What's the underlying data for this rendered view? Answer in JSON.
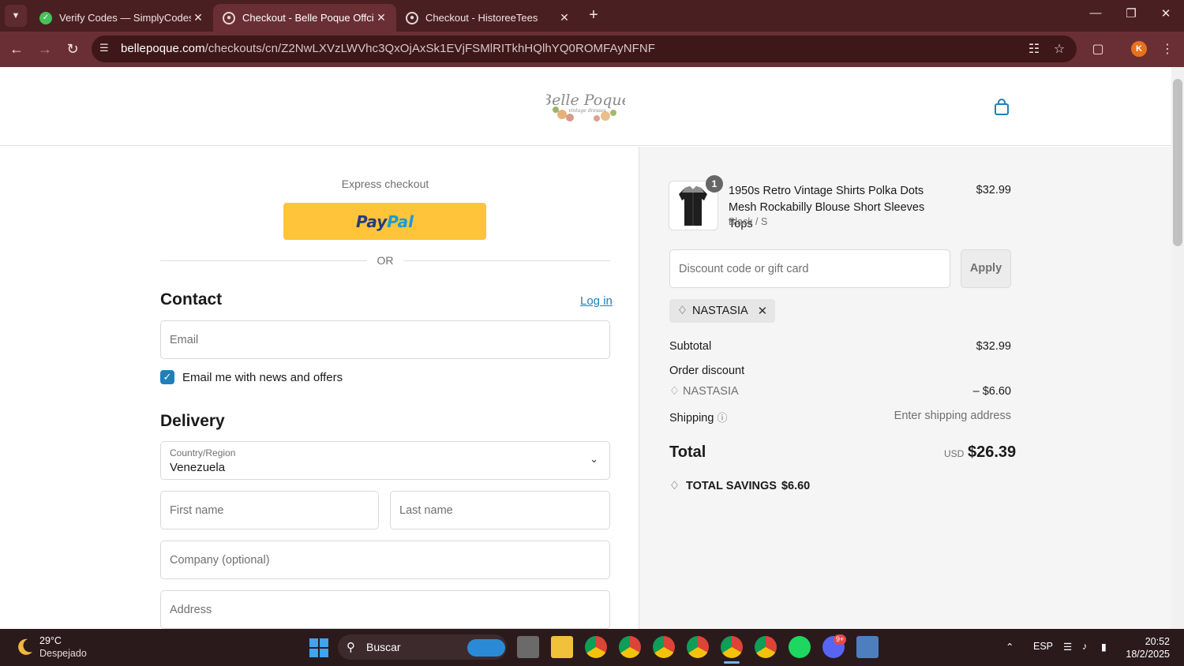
{
  "browser": {
    "tabs": [
      {
        "title": "Verify Codes — SimplyCodes",
        "active": false
      },
      {
        "title": "Checkout - Belle Poque Offcial",
        "active": true
      },
      {
        "title": "Checkout - HistoreeTees",
        "active": false
      }
    ],
    "url_host": "bellepoque.com",
    "url_path": "/checkouts/cn/Z2NwLXVzLWVhc3QxOjAxSk1EVjFSMlRITkhHQlhYQ0ROMFAyNFNF",
    "profile_initial": "K",
    "accent": "#6a2f34"
  },
  "store": {
    "logo_text": "Belle Poque",
    "logo_sub": "vintage dresses"
  },
  "checkout": {
    "express_label": "Express checkout",
    "paypal_pay": "Pay",
    "paypal_pal": "Pal",
    "or_label": "OR",
    "contact_heading": "Contact",
    "login_link": "Log in",
    "email_placeholder": "Email",
    "newsletter_label": "Email me with news and offers",
    "newsletter_checked": true,
    "delivery_heading": "Delivery",
    "country_label": "Country/Region",
    "country_value": "Venezuela",
    "first_name_placeholder": "First name",
    "last_name_placeholder": "Last name",
    "company_placeholder": "Company (optional)",
    "address_placeholder": "Address"
  },
  "summary": {
    "item": {
      "quantity": "1",
      "name": "1950s Retro Vintage Shirts Polka Dots Mesh Rockabilly Blouse Short Sleeves Tops",
      "variant": "Black / S",
      "price": "$32.99"
    },
    "discount_placeholder": "Discount code or gift card",
    "apply_label": "Apply",
    "applied_code": "NASTASIA",
    "subtotal_label": "Subtotal",
    "subtotal_value": "$32.99",
    "order_discount_label": "Order discount",
    "discount_code": "NASTASIA",
    "discount_value": "– $6.60",
    "shipping_label": "Shipping",
    "shipping_value": "Enter shipping address",
    "total_label": "Total",
    "currency": "USD",
    "total_value": "$26.39",
    "savings_label": "TOTAL SAVINGS",
    "savings_value": "$6.60"
  },
  "taskbar": {
    "temperature": "29°C",
    "weather": "Despejado",
    "search_label": "Buscar",
    "language": "ESP",
    "time": "20:52",
    "date": "18/2/2025",
    "discord_badge": "9+"
  }
}
